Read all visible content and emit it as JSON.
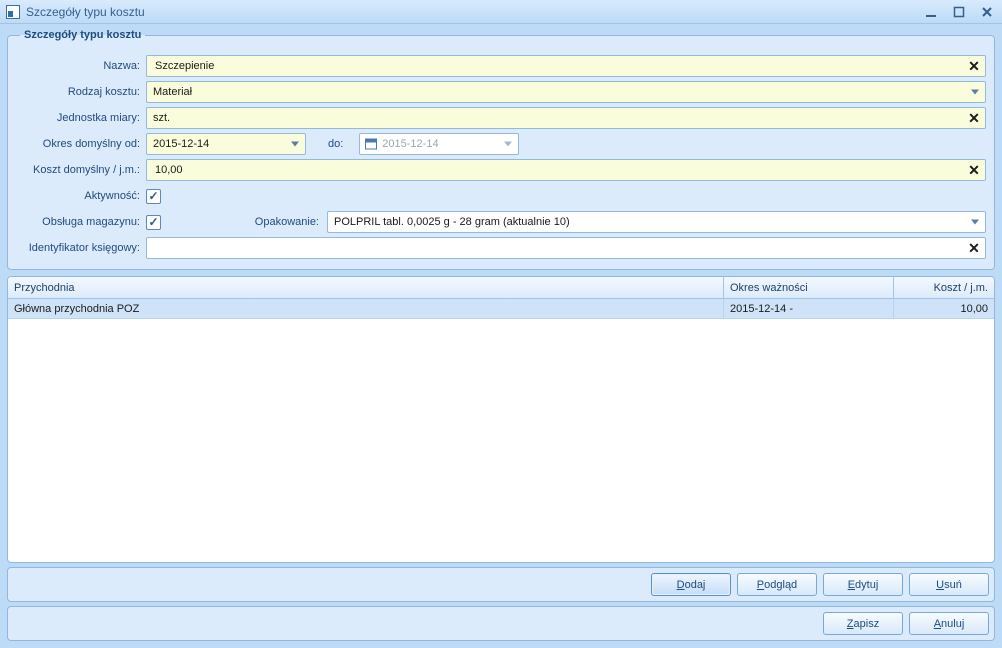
{
  "window": {
    "title": "Szczegóły typu kosztu"
  },
  "group": {
    "legend": "Szczegóły typu kosztu"
  },
  "form": {
    "name_label": "Nazwa:",
    "name_value": "Szczepienie",
    "cost_type_label": "Rodzaj kosztu:",
    "cost_type_value": "Materiał",
    "unit_label": "Jednostka miary:",
    "unit_value": "szt.",
    "period_from_label": "Okres domyślny od:",
    "period_from_value": "2015-12-14",
    "period_to_label": "do:",
    "period_to_placeholder": "2015-12-14",
    "default_cost_label": "Koszt domyślny / j.m.:",
    "default_cost_value": "10,00",
    "active_label": "Aktywność:",
    "warehouse_label": "Obsługa magazynu:",
    "package_label": "Opakowanie:",
    "package_value": "POLPRIL tabl. 0,0025 g - 28 gram (aktualnie 10)",
    "accounting_id_label": "Identyfikator księgowy:",
    "accounting_id_value": ""
  },
  "grid": {
    "headers": {
      "clinic": "Przychodnia",
      "validity": "Okres ważności",
      "cost": "Koszt / j.m."
    },
    "rows": [
      {
        "clinic": "Główna przychodnia POZ",
        "validity": "2015-12-14 -",
        "cost": "10,00"
      }
    ]
  },
  "buttons": {
    "add": "Dodaj",
    "add_ul": "D",
    "preview": "Podgląd",
    "preview_ul": "P",
    "edit": "Edytuj",
    "edit_ul": "E",
    "delete": "Usuń",
    "delete_ul": "U",
    "save": "Zapisz",
    "save_ul": "Z",
    "cancel": "Anuluj",
    "cancel_ul": "A"
  }
}
